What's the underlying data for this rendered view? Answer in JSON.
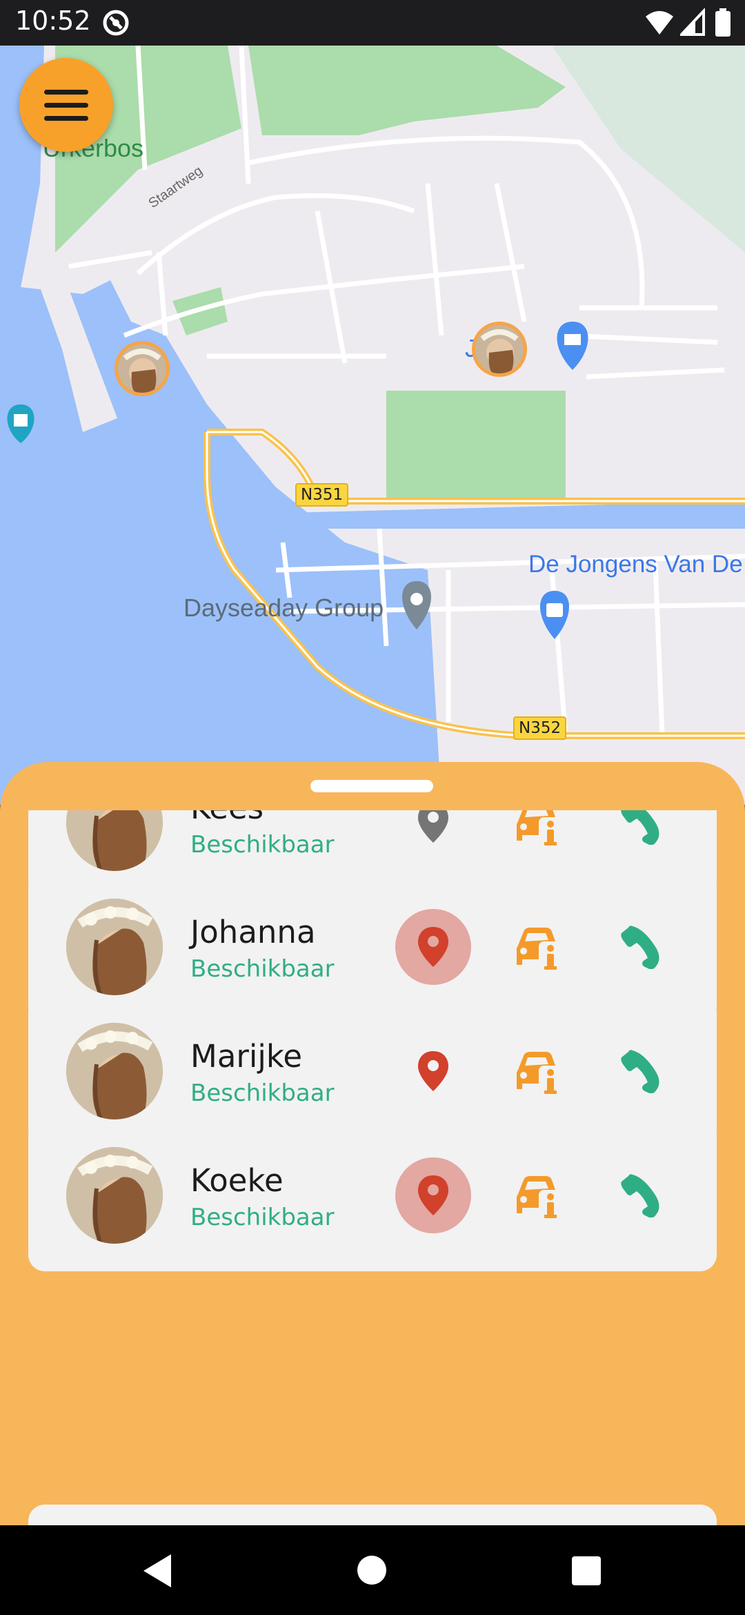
{
  "status_bar": {
    "time": "10:52",
    "icons": [
      "app-notification-icon",
      "wifi-icon",
      "signal-icon",
      "battery-icon"
    ]
  },
  "map": {
    "labels": {
      "urkerbos": "Urkerbos",
      "staartweg": "Staartweg",
      "jumbo_partial": "J       bo",
      "jongens": "De Jongens Van De",
      "dayseaday": "Dayseaday Group",
      "n351": "N351",
      "n352": "N352"
    },
    "colors": {
      "land": "#eeebf0",
      "water": "#9cc0f9",
      "park": "#abdcab",
      "road": "#ffffff",
      "highway": "#f9c24c"
    }
  },
  "menu_button": {
    "icon": "hamburger-menu-icon",
    "color": "#f8a12a"
  },
  "contacts": [
    {
      "name": "Kees",
      "status": "Beschikbaar",
      "location_state": "inactive"
    },
    {
      "name": "Johanna",
      "status": "Beschikbaar",
      "location_state": "selected"
    },
    {
      "name": "Marijke",
      "status": "Beschikbaar",
      "location_state": "active"
    },
    {
      "name": "Koeke",
      "status": "Beschikbaar",
      "location_state": "selected"
    }
  ],
  "theme": {
    "sheet": "#f8b65b",
    "card": "#f2f2f2",
    "status_green": "#2fae86",
    "pin_red": "#d1412c",
    "pin_grey": "#757575",
    "car_orange": "#f49a2b",
    "phone_green": "#2fae86"
  }
}
